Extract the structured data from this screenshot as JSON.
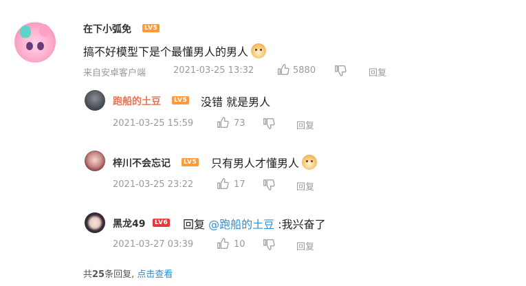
{
  "main_comment": {
    "username": "在下小弧免",
    "level": "LV5",
    "content": "搞不好模型下是个最懂男人的男人",
    "emoji": "dog-emoji",
    "source": "来自安卓客户端",
    "timestamp": "2021-03-25 13:32",
    "likes": "5880",
    "reply_label": "回复"
  },
  "replies": [
    {
      "username": "跑船的土豆",
      "level": "LV5",
      "content": "没错 就是男人",
      "timestamp": "2021-03-25 15:59",
      "likes": "73",
      "reply_label": "回复"
    },
    {
      "username": "梓川不会忘记",
      "level": "LV5",
      "content": "只有男人才懂男人",
      "emoji": "dog-emoji",
      "timestamp": "2021-03-25 23:22",
      "likes": "17",
      "reply_label": "回复"
    },
    {
      "username": "黑龙49",
      "level": "LV6",
      "content_prefix": "回复",
      "mention": "@跑船的土豆",
      "content_suffix": ":我兴奋了",
      "timestamp": "2021-03-27 03:39",
      "likes": "10",
      "reply_label": "回复"
    }
  ],
  "footer": {
    "total_prefix": "共",
    "total_count": "25",
    "total_suffix": "条回复,",
    "view_link": "点击查看"
  },
  "colors": {
    "accent_name": "#eb7350",
    "link": "#2a8fcf",
    "lv5": "#ff9a36",
    "lv6": "#e83a3a"
  }
}
